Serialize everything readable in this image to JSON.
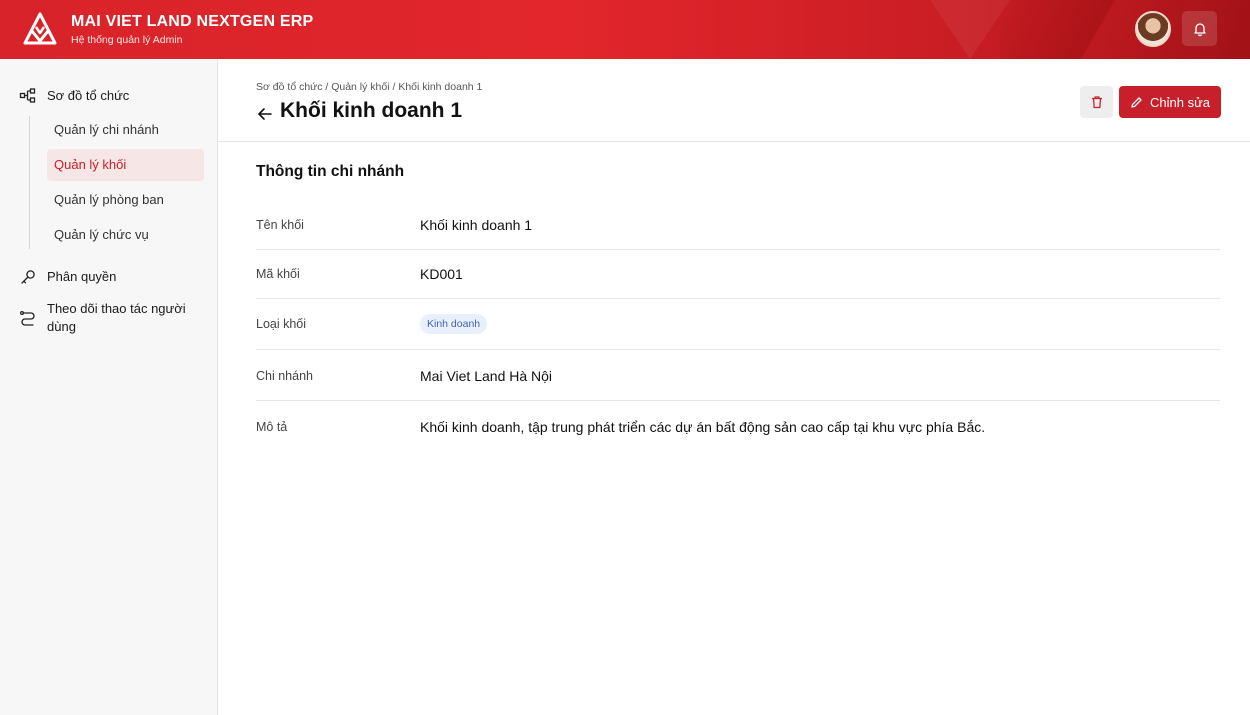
{
  "header": {
    "brand_title": "MAI VIET LAND NEXTGEN ERP",
    "brand_subtitle": "Hệ thống quản lý Admin",
    "logo_icon": "mai-viet-land-logo",
    "notification_icon": "bell-icon"
  },
  "sidebar": {
    "groups": [
      {
        "label": "Sơ đồ tổ chức",
        "icon": "org-chart-icon",
        "children": [
          {
            "label": "Quản lý chi nhánh",
            "active": false
          },
          {
            "label": "Quản lý khối",
            "active": true
          },
          {
            "label": "Quản lý phòng ban",
            "active": false
          },
          {
            "label": "Quản lý chức vụ",
            "active": false
          }
        ]
      },
      {
        "label": "Phân quyền",
        "icon": "key-icon"
      },
      {
        "label": "Theo dõi thao tác người dùng",
        "icon": "route-icon"
      }
    ]
  },
  "main": {
    "breadcrumb": "Sơ đồ tổ chức / Quản lý khối / Khối kinh doanh 1",
    "title": "Khối kinh doanh 1",
    "edit_label": "Chỉnh sửa",
    "section_title": "Thông tin chi nhánh",
    "fields": [
      {
        "label": "Tên khối",
        "value": "Khối kinh doanh 1"
      },
      {
        "label": "Mã khối",
        "value": "KD001"
      },
      {
        "label": "Loại khối",
        "value": "Kinh doanh"
      },
      {
        "label": "Chi nhánh",
        "value": "Mai Viet Land Hà Nội"
      },
      {
        "label": "Mô tả",
        "value": "Khối kinh doanh, tập trung phát triển các dự án bất động sản cao cấp tại khu vực phía Bắc."
      }
    ]
  },
  "colors": {
    "brand_red": "#c8202a",
    "active_bg": "#f7e6e6",
    "tag_bg": "#eaf0fb",
    "tag_text": "#3c64b8"
  }
}
